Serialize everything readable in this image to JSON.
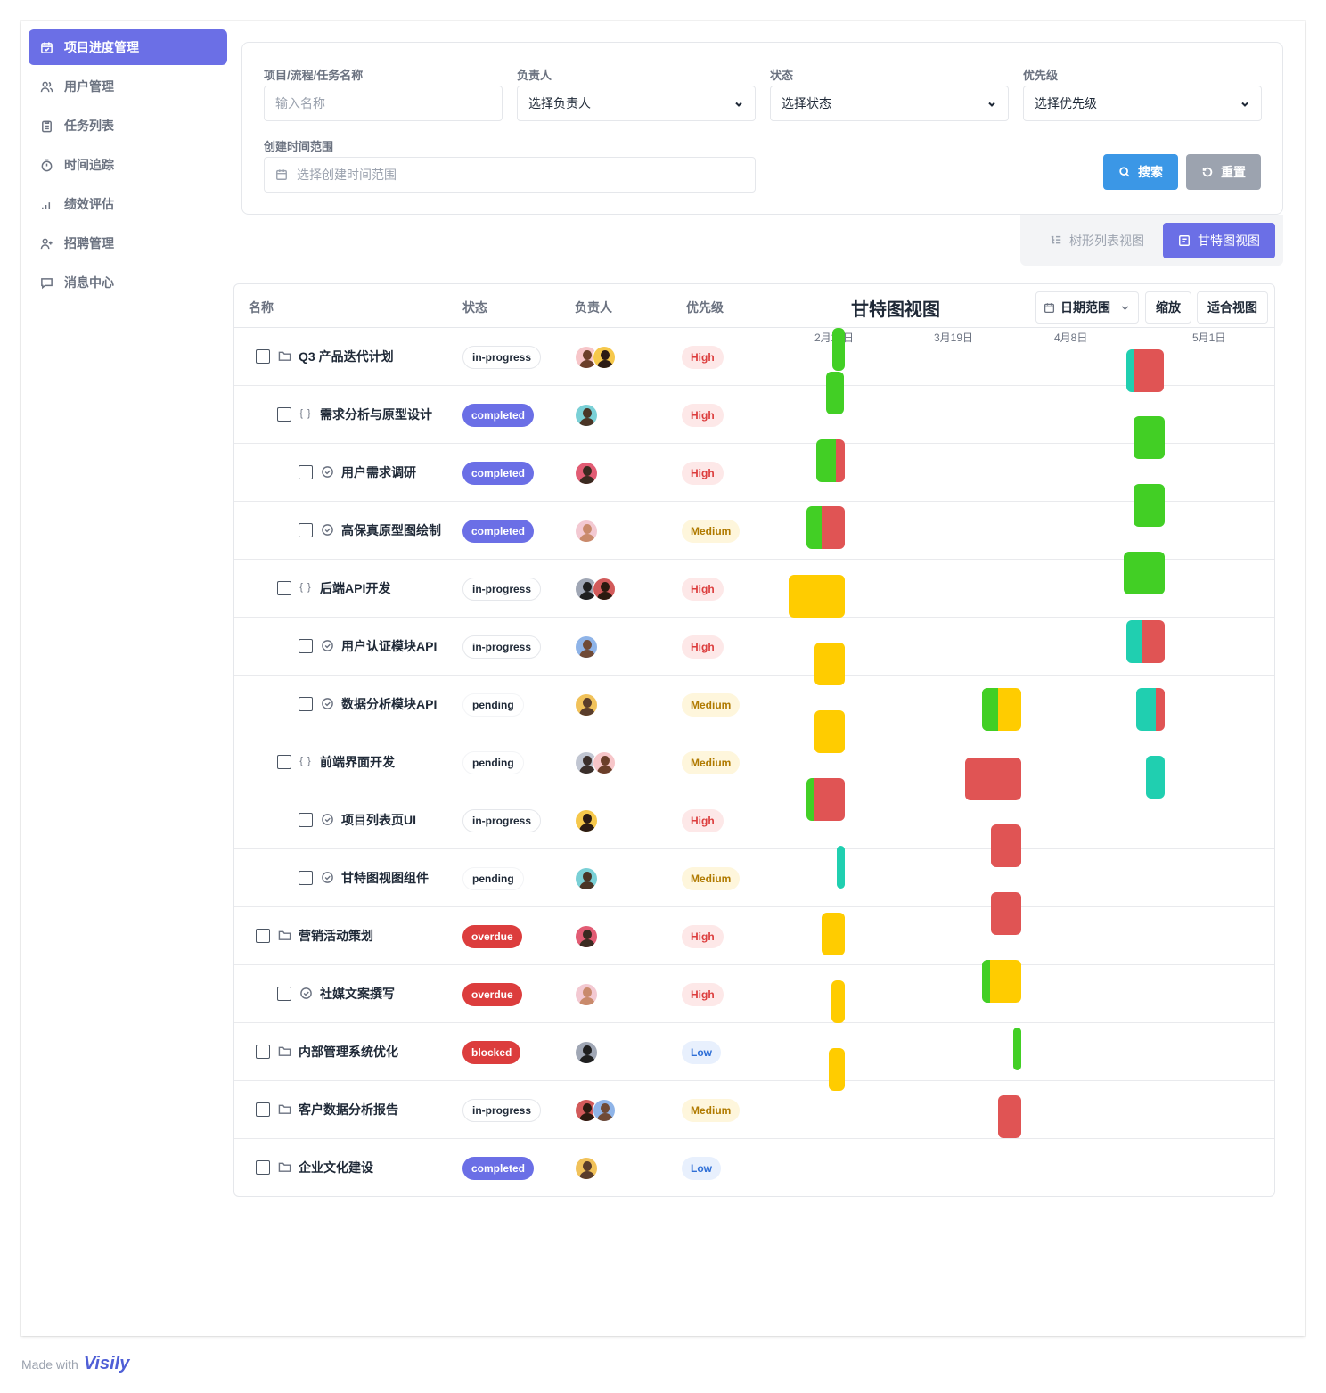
{
  "sidebar": {
    "items": [
      {
        "label": "项目进度管理",
        "icon": "calendar-check-icon",
        "active": true
      },
      {
        "label": "用户管理",
        "icon": "users-icon",
        "active": false
      },
      {
        "label": "任务列表",
        "icon": "clipboard-icon",
        "active": false
      },
      {
        "label": "时间追踪",
        "icon": "timer-icon",
        "active": false
      },
      {
        "label": "绩效评估",
        "icon": "bar-chart-icon",
        "active": false
      },
      {
        "label": "招聘管理",
        "icon": "user-plus-icon",
        "active": false
      },
      {
        "label": "消息中心",
        "icon": "message-icon",
        "active": false
      }
    ]
  },
  "filters": {
    "name_label": "项目/流程/任务名称",
    "name_placeholder": "输入名称",
    "owner_label": "负责人",
    "owner_value": "选择负责人",
    "status_label": "状态",
    "status_value": "选择状态",
    "priority_label": "优先级",
    "priority_value": "选择优先级",
    "date_label": "创建时间范围",
    "date_placeholder": "选择创建时间范围",
    "search_label": "搜索",
    "reset_label": "重置"
  },
  "view_toggle": {
    "tree_label": "树形列表视图",
    "gantt_label": "甘特图视图",
    "active": "gantt"
  },
  "table": {
    "headers": {
      "name": "名称",
      "status": "状态",
      "owner": "负责人",
      "priority": "优先级"
    },
    "gantt_title": "甘特图视图",
    "toolbar": {
      "date_range": "日期范围",
      "zoom": "缩放",
      "fit": "适合视图"
    },
    "axis_labels": [
      "2月28日",
      "3月19日",
      "4月8日",
      "5月1日"
    ],
    "rows": [
      {
        "name": "Q3 产品迭代计划",
        "type": "project",
        "level": 0,
        "status": "in-progress",
        "priority": "High",
        "avatars": 2
      },
      {
        "name": "需求分析与原型设计",
        "type": "process",
        "level": 1,
        "status": "completed",
        "priority": "High",
        "avatars": 1
      },
      {
        "name": "用户需求调研",
        "type": "task",
        "level": 2,
        "status": "completed",
        "priority": "High",
        "avatars": 1
      },
      {
        "name": "高保真原型图绘制",
        "type": "task",
        "level": 2,
        "status": "completed",
        "priority": "Medium",
        "avatars": 1
      },
      {
        "name": "后端API开发",
        "type": "process",
        "level": 1,
        "status": "in-progress",
        "priority": "High",
        "avatars": 2
      },
      {
        "name": "用户认证模块API",
        "type": "task",
        "level": 2,
        "status": "in-progress",
        "priority": "High",
        "avatars": 1
      },
      {
        "name": "数据分析模块API",
        "type": "task",
        "level": 2,
        "status": "pending",
        "priority": "Medium",
        "avatars": 1
      },
      {
        "name": "前端界面开发",
        "type": "process",
        "level": 1,
        "status": "pending",
        "priority": "Medium",
        "avatars": 2
      },
      {
        "name": "项目列表页UI",
        "type": "task",
        "level": 2,
        "status": "in-progress",
        "priority": "High",
        "avatars": 1
      },
      {
        "name": "甘特图视图组件",
        "type": "task",
        "level": 2,
        "status": "pending",
        "priority": "Medium",
        "avatars": 1
      },
      {
        "name": "营销活动策划",
        "type": "project",
        "level": 0,
        "status": "overdue",
        "priority": "High",
        "avatars": 1
      },
      {
        "name": "社媒文案撰写",
        "type": "task",
        "level": 1,
        "status": "overdue",
        "priority": "High",
        "avatars": 1
      },
      {
        "name": "内部管理系统优化",
        "type": "project",
        "level": 0,
        "status": "blocked",
        "priority": "Low",
        "avatars": 1
      },
      {
        "name": "客户数据分析报告",
        "type": "project",
        "level": 0,
        "status": "in-progress",
        "priority": "Medium",
        "avatars": 2
      },
      {
        "name": "企业文化建设",
        "type": "project",
        "level": 0,
        "status": "completed",
        "priority": "Low",
        "avatars": 1
      }
    ]
  },
  "gantt_colors": {
    "green": "#42cf25",
    "red": "#e05454",
    "yellow": "#ffcc00",
    "teal": "#20cfb0"
  },
  "footer": {
    "made_with": "Made with",
    "brand": "Visily"
  }
}
